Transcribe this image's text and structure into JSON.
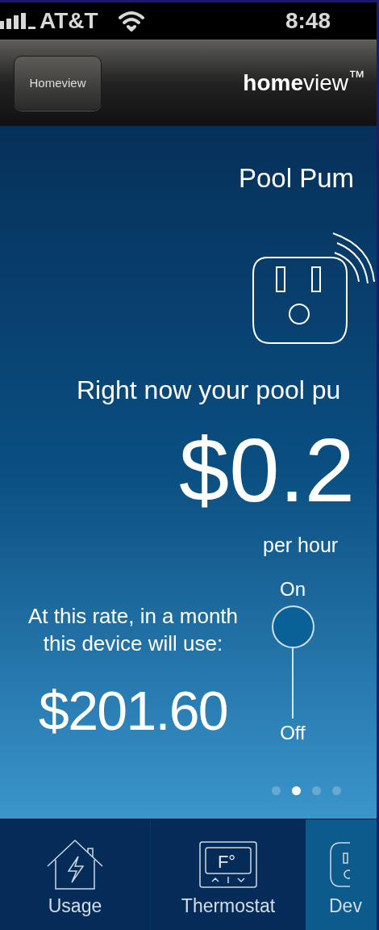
{
  "status_bar": {
    "carrier": "AT&T",
    "time": "8:48"
  },
  "nav_bar": {
    "back_button": "Homeview",
    "logo": "**home**view$^{™}$"
  },
  "device": {
    "name": "Pool Pum",
    "headline": "Right now your pool pu",
    "rate": "$0.2",
    "rate_unit": "per hour",
    "monthly_label": "At this rate, in a month this device will use:",
    "monthly_cost": "$201.60",
    "toggle": {
      "on_label": "On",
      "off_label": "Off",
      "on": true
    }
  },
  "page_dots": [
    {
      "selected": false
    },
    {
      "selected": true
    },
    {
      "selected": false
    },
    {
      "selected": false
    }
  ],
  "tabs": [
    {
      "kind": "usage",
      "label": "Usage",
      "selected": false
    },
    {
      "kind": "thermostat",
      "label": "Thermostat",
      "icon_text": "F°",
      "selected": false
    },
    {
      "kind": "devices",
      "label": "Dev",
      "selected": true
    }
  ]
}
